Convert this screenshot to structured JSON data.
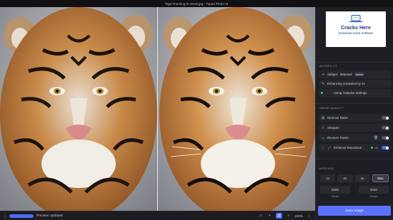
{
  "window": {
    "title": "Tiger Running In Snow.jpg - Topaz Photo AI"
  },
  "ad": {
    "title": "Cracks Here",
    "subtitle": "Download Crack Software",
    "logo_icon": "laptop-icon"
  },
  "autopilot": {
    "label": "AUTOPILOT",
    "subject": {
      "prefix": "Subject",
      "value": "detected",
      "action": "Select"
    },
    "enhancing": "Enhancing resolution by 4x",
    "settings": "Using Autopilot Settings"
  },
  "image_quality": {
    "label": "IMAGE QUALITY",
    "items": [
      {
        "label": "Remove Noise",
        "icon": "noise-icon",
        "enabled": false
      },
      {
        "label": "Sharpen",
        "icon": "sharpen-icon",
        "enabled": false
      },
      {
        "label": "Recover Faces",
        "icon": "face-icon",
        "enabled": false
      },
      {
        "label": "Enhance Resolution",
        "icon": "resolution-icon",
        "badge": "4x",
        "enabled": true
      }
    ]
  },
  "upscale": {
    "label": "UPSCALE",
    "scales": [
      "1x",
      "2x",
      "4x",
      "Max"
    ],
    "selected": "Max",
    "width": {
      "value": "6300",
      "label": "Width"
    },
    "height": {
      "value": "4032",
      "label": "Height"
    }
  },
  "save_label": "Save Image",
  "status": {
    "text": "Preview Updated",
    "progress": 1.0
  },
  "view": {
    "zoom": "100%",
    "icons": [
      "single-view-icon",
      "split-view-icon",
      "side-by-side-icon",
      "zoom-icon"
    ]
  },
  "colors": {
    "accent": "#5b72ff",
    "panel": "#1e1e24",
    "background": "#16161a"
  }
}
